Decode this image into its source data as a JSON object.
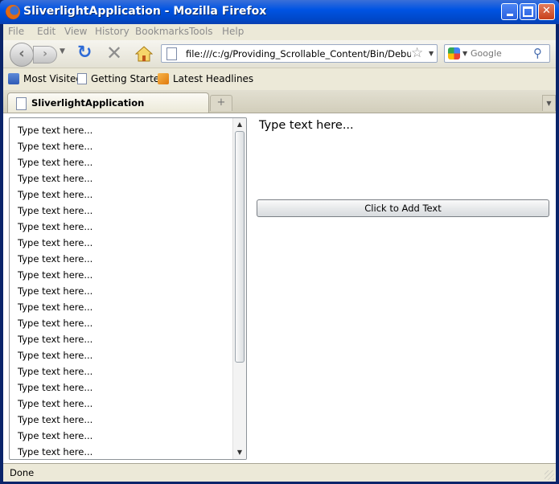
{
  "window": {
    "title": "SliverlightApplication - Mozilla Firefox",
    "controls": {
      "minimize": "minimize",
      "maximize": "maximize",
      "close": "✕"
    }
  },
  "menu": {
    "items": [
      "File",
      "Edit",
      "View",
      "History",
      "Bookmarks",
      "Tools",
      "Help"
    ]
  },
  "navbar": {
    "url": "file:///c:/g/Providing_Scrollable_Content/Bin/Debug/TestPage.html",
    "search_placeholder": "Google"
  },
  "bookmarks": {
    "items": [
      "Most Visited",
      "Getting Started",
      "Latest Headlines"
    ]
  },
  "tabs": {
    "active_label": "SliverlightApplication",
    "new_tab": "+"
  },
  "content": {
    "list_items": [
      "Type text here...",
      "Type text here...",
      "Type text here...",
      "Type text here...",
      "Type text here...",
      "Type text here...",
      "Type text here...",
      "Type text here...",
      "Type text here...",
      "Type text here...",
      "Type text here...",
      "Type text here...",
      "Type text here...",
      "Type text here...",
      "Type text here...",
      "Type text here...",
      "Type text here...",
      "Type text here...",
      "Type text here...",
      "Type text here...",
      "Type text here..."
    ],
    "output_text": "Type text here...",
    "add_button_label": "Click to Add Text",
    "scroll_position": 0
  },
  "status": {
    "text": "Done"
  },
  "colors": {
    "titlebar": "#0054e3",
    "chrome": "#ece9d8",
    "content_bg": "#ffffff"
  },
  "icons": [
    "firefox-icon",
    "back-icon",
    "forward-icon",
    "reload-icon",
    "stop-icon",
    "home-icon",
    "page-icon",
    "star-icon",
    "google-icon",
    "magnifier-icon",
    "folder-icon",
    "rss-icon"
  ]
}
